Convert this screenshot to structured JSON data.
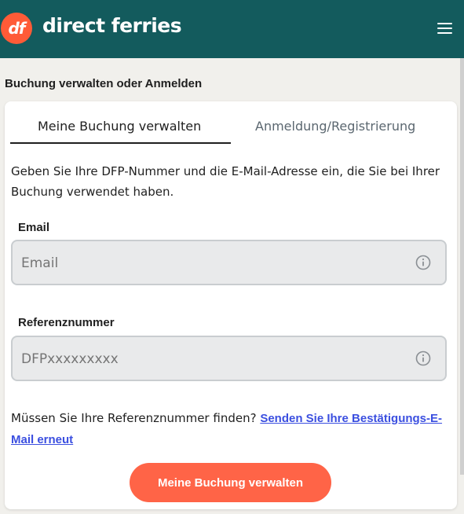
{
  "header": {
    "logo_text": "df",
    "brand": "direct ferries",
    "menu_icon": "hamburger-menu-icon",
    "background_color": "#135b5d",
    "logo_color": "#ff5b37"
  },
  "section_title": "Buchung verwalten oder Anmelden",
  "tabs": [
    {
      "label": "Meine Buchung verwalten",
      "active": true
    },
    {
      "label": "Anmeldung/Registrierung",
      "active": false
    }
  ],
  "intro": "Geben Sie Ihre DFP-Nummer und die E-Mail-Adresse ein, die Sie bei Ihrer Buchung verwendet haben.",
  "email_field": {
    "label": "Email",
    "placeholder": "Email",
    "info_icon": "info-circle-icon"
  },
  "reference_field": {
    "label": "Referenznummer",
    "placeholder": "DFPxxxxxxxxx",
    "info_icon": "info-circle-icon"
  },
  "help": {
    "text": "Müssen Sie Ihre Referenznummer finden? ",
    "link": "Senden Sie Ihre Bestätigungs-E-Mail erneut",
    "link_color": "#3b4fe0"
  },
  "submit_button": {
    "label": "Meine Buchung verwalten",
    "color": "#ff6447"
  }
}
